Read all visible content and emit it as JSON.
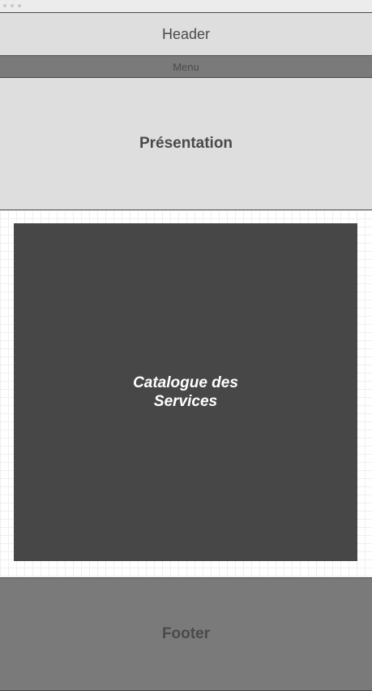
{
  "header": {
    "label": "Header"
  },
  "menu": {
    "label": "Menu"
  },
  "presentation": {
    "label": "Présentation"
  },
  "catalogue": {
    "label": "Catalogue des\nServices"
  },
  "footer": {
    "label": "Footer"
  },
  "colors": {
    "header_bg": "#dedede",
    "menu_bg": "#7a7a7a",
    "catalogue_bg": "#474747",
    "footer_bg": "#7a7a7a",
    "text": "#4a4a4a"
  }
}
